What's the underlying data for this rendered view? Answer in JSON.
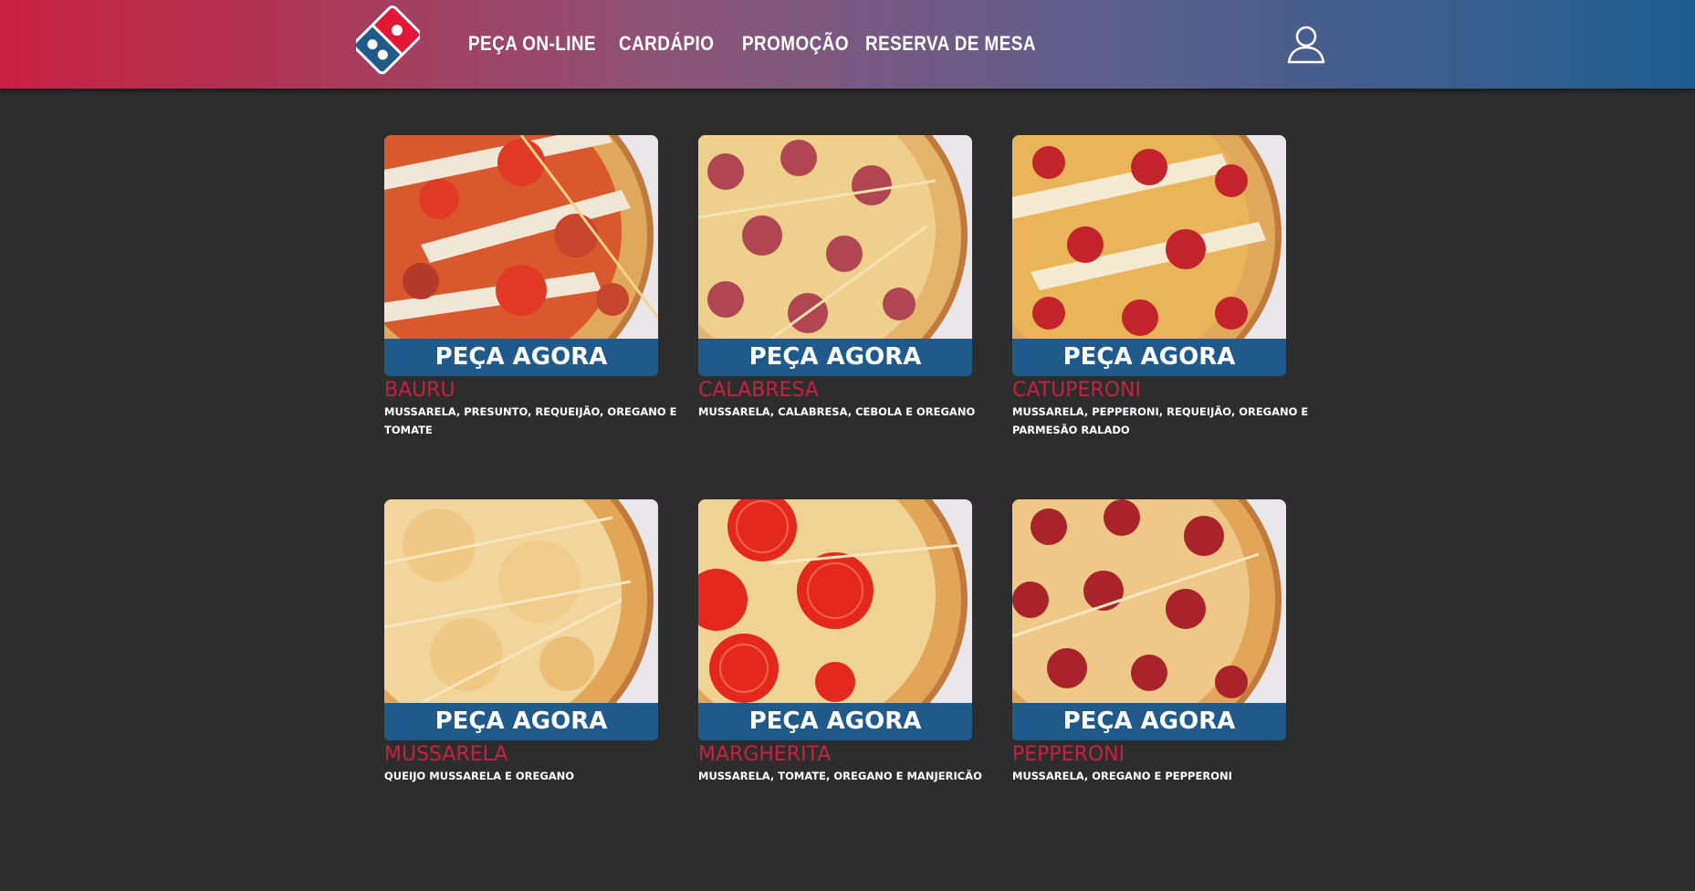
{
  "header": {
    "nav": [
      {
        "label": "PEÇA ON-LINE"
      },
      {
        "label": "CARDÁPIO"
      },
      {
        "label": "PROMOÇÃO"
      },
      {
        "label": "RESERVA DE MESA"
      }
    ],
    "logo_icon": "domino-logo-icon",
    "user_icon": "user-icon",
    "colors": {
      "gradient_start": "#c8203f",
      "gradient_end": "#1f5d8f"
    }
  },
  "colors": {
    "background": "#2d2d2d",
    "button": "#1f5a8a",
    "name": "#c8203f"
  },
  "products": [
    {
      "button": "PEÇA AGORA",
      "name": "BAURU",
      "desc": "MUSSARELA, PRESUNTO, REQUEIJÃO, OREGANO E TOMATE"
    },
    {
      "button": "PEÇA AGORA",
      "name": "CALABRESA",
      "desc": "MUSSARELA, CALABRESA, CEBOLA E OREGANO"
    },
    {
      "button": "PEÇA AGORA",
      "name": "CATUPERONI",
      "desc": "MUSSARELA, PEPPERONI, REQUEIJÃO, OREGANO E PARMESÃO RALADO"
    },
    {
      "button": "PEÇA AGORA",
      "name": "MUSSARELA",
      "desc": "QUEIJO MUSSARELA E OREGANO"
    },
    {
      "button": "PEÇA AGORA",
      "name": "MARGHERITA",
      "desc": "MUSSARELA, TOMATE, OREGANO E MANJERICÃO"
    },
    {
      "button": "PEÇA AGORA",
      "name": "PEPPERONI",
      "desc": "MUSSARELA, OREGANO E PEPPERONI"
    }
  ]
}
